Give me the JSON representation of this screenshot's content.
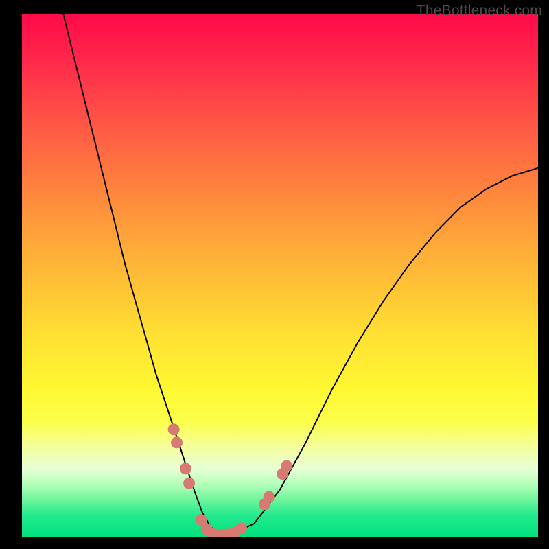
{
  "watermark": "TheBottleneck.com",
  "chart_data": {
    "type": "line",
    "title": "",
    "xlabel": "",
    "ylabel": "",
    "xlim": [
      0,
      100
    ],
    "ylim": [
      0,
      100
    ],
    "series": [
      {
        "name": "curve",
        "x": [
          8,
          10,
          12,
          14,
          16,
          18,
          20,
          22,
          24,
          26,
          28,
          30,
          32,
          33.5,
          35,
          36.5,
          38,
          40,
          45,
          50,
          55,
          60,
          65,
          70,
          75,
          80,
          85,
          90,
          95,
          100
        ],
        "y": [
          100,
          92,
          84,
          76,
          68,
          60,
          52,
          45,
          38,
          31,
          25,
          19,
          13,
          8.5,
          4.5,
          2,
          0.5,
          0.2,
          2.5,
          9,
          18,
          28,
          37,
          45,
          52,
          58,
          63,
          66.5,
          69,
          70.5
        ]
      }
    ],
    "markers": {
      "name": "highlight-dots",
      "color": "#d77a74",
      "points": [
        {
          "x": 29.4,
          "y": 20.5
        },
        {
          "x": 30.0,
          "y": 18.0
        },
        {
          "x": 31.7,
          "y": 13.0
        },
        {
          "x": 32.4,
          "y": 10.2
        },
        {
          "x": 34.7,
          "y": 3.2
        },
        {
          "x": 35.8,
          "y": 1.4
        },
        {
          "x": 37.0,
          "y": 0.5
        },
        {
          "x": 38.3,
          "y": 0.3
        },
        {
          "x": 39.8,
          "y": 0.4
        },
        {
          "x": 41.2,
          "y": 0.8
        },
        {
          "x": 42.5,
          "y": 1.6
        },
        {
          "x": 47.0,
          "y": 6.2
        },
        {
          "x": 47.9,
          "y": 7.6
        },
        {
          "x": 50.5,
          "y": 12.0
        },
        {
          "x": 51.3,
          "y": 13.5
        }
      ]
    },
    "gradient_stops": [
      {
        "pos": 0.0,
        "color": "#ff0a4a"
      },
      {
        "pos": 0.5,
        "color": "#ffd234"
      },
      {
        "pos": 0.8,
        "color": "#fbff55"
      },
      {
        "pos": 1.0,
        "color": "#00e27e"
      }
    ]
  }
}
